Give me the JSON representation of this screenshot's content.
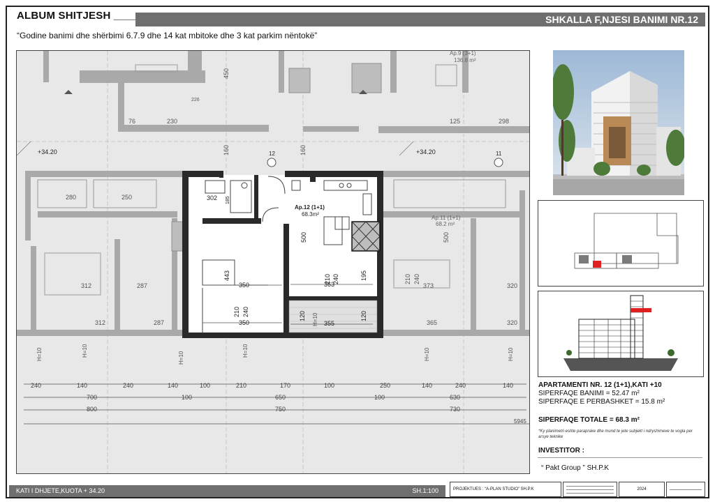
{
  "header": {
    "album_title": "ALBUM SHITJESH ____",
    "sheet_title": "SHKALLA F,NJESI BANIMI NR.12",
    "subtitle": "“Godine banimi dhe shërbimi 6.7.9 dhe 14 kat mbitoke dhe 3 kat parkim nëntokë”"
  },
  "plan": {
    "level_marks": [
      "+34.20",
      "+34.20"
    ],
    "axis_marks": [
      "12",
      "11"
    ],
    "units": {
      "main": {
        "name": "Ap.12 (1+1)",
        "area": "68.3m²"
      },
      "left_neighbor": {
        "name": "Ap.11 (1+1)",
        "area": "68.2 m²"
      },
      "top_neighbor": {
        "name": "Ap.9 (3+1)",
        "area": "136.8 m²"
      }
    },
    "dims": {
      "d302": "302",
      "d185": "185",
      "d500": "500",
      "d443": "443",
      "d350a": "350",
      "d350b": "350",
      "d210a": "210",
      "d240a": "240",
      "d210b": "210",
      "d240b": "240",
      "d363": "363",
      "d195": "195",
      "d120a": "120",
      "d355": "355",
      "d120b": "120",
      "d280": "280",
      "d250": "250",
      "d312a": "312",
      "d287a": "287",
      "d312b": "312",
      "d287b": "287",
      "d373": "373",
      "d320a": "320",
      "d365": "365",
      "d320b": "320",
      "d500b": "500",
      "d210c": "210",
      "d240c": "240",
      "d160a": "160",
      "d160b": "160",
      "d450": "450",
      "d230": "230",
      "d125": "125",
      "d298": "298",
      "d76": "76",
      "d226": "226"
    },
    "h_marks": [
      "H=10",
      "H=10",
      "H=10",
      "H=10",
      "H=10",
      "H=10",
      "H=10"
    ],
    "dim_row1": [
      "240",
      "140",
      "240",
      "140",
      "100",
      "210",
      "170",
      "100",
      "250",
      "140",
      "240",
      "140"
    ],
    "dim_row2": [
      "700",
      "100",
      "650",
      "100",
      "630"
    ],
    "dim_row3": [
      "800",
      "750",
      "730"
    ],
    "total_dim": "5945"
  },
  "apartment": {
    "title": "APARTAMENTI NR. 12 (1+1),KATI +10",
    "living_area": "SIPERFAQE BANIMI = 52.47 m²",
    "common_area": "SIPERFAQE E PERBASHKET = 15.8 m²",
    "total_area": "SIPERFAQE TOTALE = 68.3 m²",
    "note": "*Ky planimetri eshte paraprake dhe mund te jete subjekt i ndryshimeve te vogla per arsye teknike"
  },
  "investor": {
    "label": "INVESTITOR :",
    "name": "“ Pakt Group ” SH.P.K"
  },
  "footer": {
    "floor": "KATI I DHJETE,KUOTA + 34.20",
    "scale": "SH.1:100",
    "designer": "PROJEKTUES : “A-PLAN STUDIO” SH.P.K",
    "year": "2024"
  },
  "colors": {
    "header_bar": "#6f6f6f",
    "highlight_red": "#e02020",
    "wall": "#2a2a2a"
  }
}
